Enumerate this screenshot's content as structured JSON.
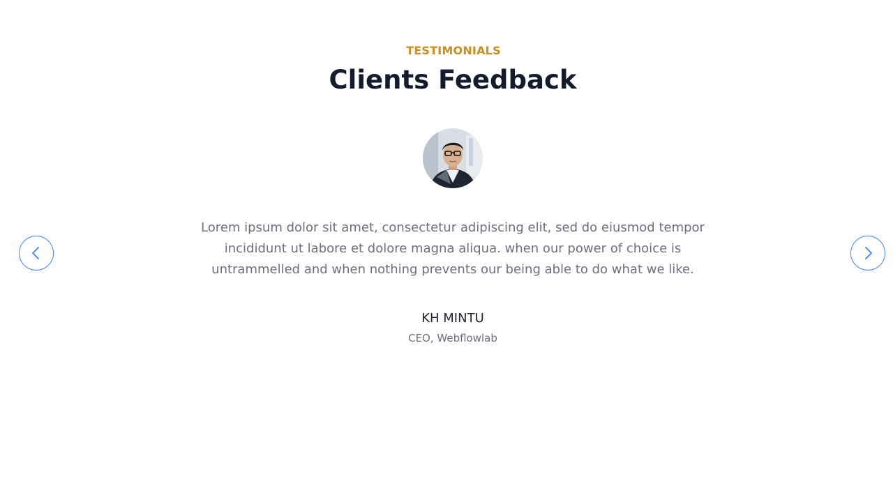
{
  "section": {
    "eyebrow": "TESTIMONIALS",
    "title": "Clients Feedback"
  },
  "testimonial": {
    "quote": "Lorem ipsum dolor sit amet, consectetur adipiscing elit, sed do eiusmod tempor incididunt ut labore et dolore magna aliqua. when our power of choice is untrammelled and when nothing prevents our being able to do what we like.",
    "name": "KH MINTU",
    "role": "CEO, Webflowlab",
    "avatar_icon": "person-portrait"
  },
  "navigation": {
    "prev_icon": "chevron-left-icon",
    "next_icon": "chevron-right-icon"
  },
  "colors": {
    "accent": "#3B82F6",
    "eyebrow": "#C98E1E",
    "heading": "#141B2D",
    "body_text": "#6B6F7E"
  }
}
